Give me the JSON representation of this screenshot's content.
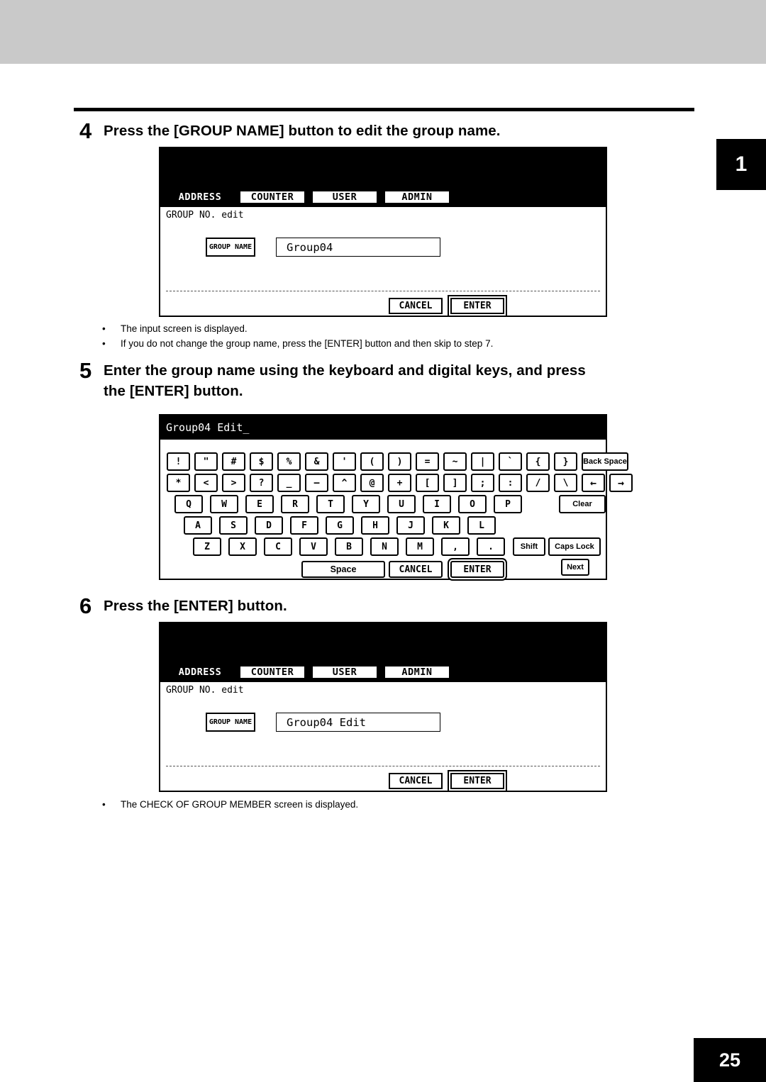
{
  "page": {
    "tab_marker": "1",
    "page_number": "25"
  },
  "steps": [
    {
      "number": "4",
      "title": "Press the [GROUP NAME] button to edit the group name.",
      "bullets": [
        "The input screen is displayed.",
        "If you do not change the group name, press the [ENTER] button and then skip to step 7."
      ]
    },
    {
      "number": "5",
      "title_line1": "Enter the group name using the keyboard and digital keys, and press",
      "title_line2": "the [ENTER] button.",
      "bullets": []
    },
    {
      "number": "6",
      "title": "Press the [ENTER] button.",
      "bullets": [
        "The CHECK OF GROUP MEMBER screen is displayed."
      ]
    }
  ],
  "screen_step4": {
    "tabs": [
      {
        "label": "ADDRESS",
        "selected": true
      },
      {
        "label": "COUNTER",
        "selected": false
      },
      {
        "label": "USER",
        "selected": false
      },
      {
        "label": "ADMIN",
        "selected": false
      }
    ],
    "heading": "GROUP NO. edit",
    "group_name_button": "GROUP NAME",
    "group_name_value": "Group04",
    "cancel_button": "CANCEL",
    "enter_button": "ENTER"
  },
  "screen_step5": {
    "title_text": "Group04 Edit_",
    "rows": [
      [
        "!",
        "\"",
        "#",
        "$",
        "%",
        "&",
        "'",
        "(",
        ")",
        "=",
        "~",
        "|",
        "`",
        "{",
        "}"
      ],
      [
        "*",
        "<",
        ">",
        "?",
        "_",
        "—",
        "^",
        "@",
        "+",
        "[",
        "]",
        ";",
        ":",
        "/",
        "\\"
      ],
      [
        "Q",
        "W",
        "E",
        "R",
        "T",
        "Y",
        "U",
        "I",
        "O",
        "P"
      ],
      [
        "A",
        "S",
        "D",
        "F",
        "G",
        "H",
        "J",
        "K",
        "L"
      ],
      [
        "Z",
        "X",
        "C",
        "V",
        "B",
        "N",
        "M",
        ",",
        "."
      ]
    ],
    "back_space": "Back Space",
    "arrow_left": "←",
    "arrow_right": "→",
    "clear": "Clear",
    "shift": "Shift",
    "caps_lock": "Caps Lock",
    "space": "Space",
    "cancel": "CANCEL",
    "enter": "ENTER",
    "next": "Next"
  },
  "screen_step6": {
    "tabs": [
      {
        "label": "ADDRESS",
        "selected": true
      },
      {
        "label": "COUNTER",
        "selected": false
      },
      {
        "label": "USER",
        "selected": false
      },
      {
        "label": "ADMIN",
        "selected": false
      }
    ],
    "heading": "GROUP NO. edit",
    "group_name_button": "GROUP NAME",
    "group_name_value": "Group04 Edit",
    "cancel_button": "CANCEL",
    "enter_button": "ENTER"
  }
}
